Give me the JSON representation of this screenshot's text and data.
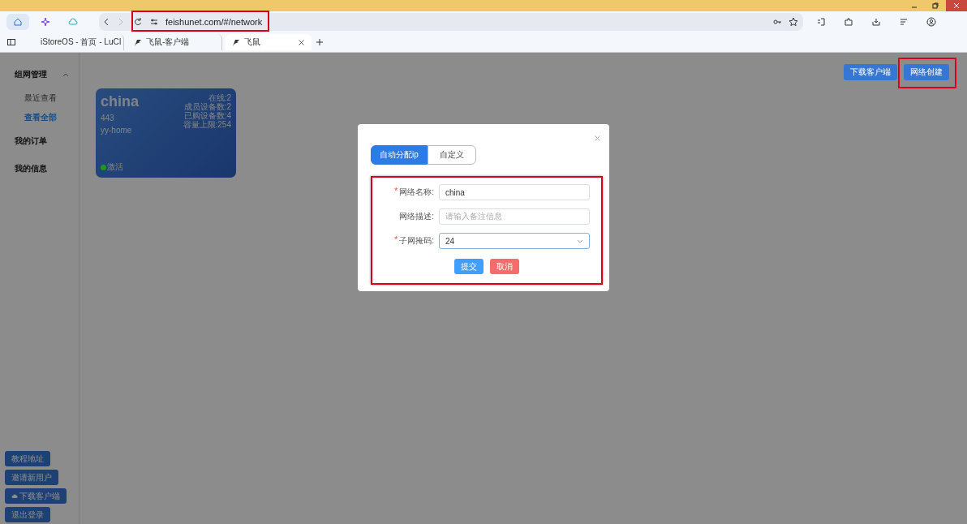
{
  "browser": {
    "address_bar": {
      "url": "feishunet.com/#/network",
      "highlighted": true
    },
    "tabs": [
      {
        "title": "iStoreOS - 首页 - LuCI",
        "selected": false
      },
      {
        "title": "飞鼠-客户端",
        "selected": false
      },
      {
        "title": "飞鼠",
        "selected": true
      }
    ]
  },
  "sidebar": {
    "items": [
      {
        "label": "组网管理",
        "expanded": true,
        "children": [
          {
            "label": "最近查看",
            "selected": false
          },
          {
            "label": "查看全部",
            "selected": true
          }
        ]
      },
      {
        "label": "我的订单"
      },
      {
        "label": "我的信息"
      }
    ],
    "buttons": [
      {
        "label": "教程地址"
      },
      {
        "label": "邀请新用户"
      },
      {
        "label": "下载客户端"
      },
      {
        "label": "退出登录"
      }
    ]
  },
  "header_buttons": [
    {
      "label": "下载客户端",
      "highlighted": false
    },
    {
      "label": "网络创建",
      "highlighted": true
    }
  ],
  "networks": [
    {
      "name": "china",
      "port": "443",
      "description": "yy-home",
      "stats": [
        "在线:2",
        "成员设备数:2",
        "已购设备数:4",
        "容量上限:254"
      ],
      "status": "激活",
      "color": "#1a9a1a"
    }
  ],
  "dialog": {
    "tabs": [
      {
        "label": "自动分配ip",
        "selected": true
      },
      {
        "label": "自定义",
        "selected": false
      }
    ],
    "form": {
      "highlighted": true,
      "fields": [
        {
          "kind": "input",
          "marker": "*",
          "label": "网络名称:",
          "value": "china"
        },
        {
          "kind": "input",
          "label": "网络描述:",
          "placeholder": "请输入备注信息"
        },
        {
          "kind": "select",
          "marker": "*",
          "label": "子网掩码:",
          "value": "24",
          "focused": true
        }
      ],
      "buttons": [
        {
          "label": "提交",
          "kind": "primary"
        },
        {
          "label": "取消",
          "kind": "danger"
        }
      ]
    }
  }
}
